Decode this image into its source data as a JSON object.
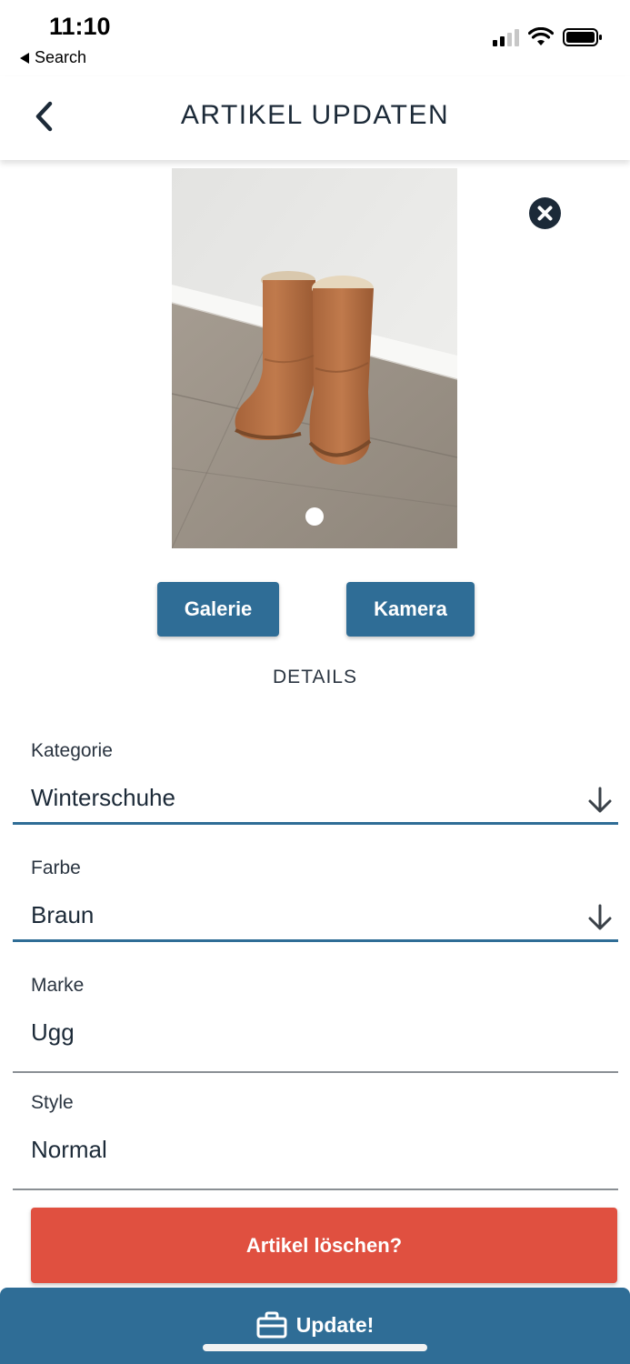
{
  "status_bar": {
    "time": "11:10",
    "back_label": "Search"
  },
  "header": {
    "title": "ARTIKEL UPDATEN"
  },
  "photo": {
    "page_count": 1,
    "current_page": 1
  },
  "buttons": {
    "gallery": "Galerie",
    "camera": "Kamera",
    "delete": "Artikel löschen?",
    "update": "Update!"
  },
  "section": {
    "details": "DETAILS"
  },
  "form": {
    "category": {
      "label": "Kategorie",
      "value": "Winterschuhe"
    },
    "color": {
      "label": "Farbe",
      "value": "Braun"
    },
    "brand": {
      "label": "Marke",
      "value": "Ugg"
    },
    "style": {
      "label": "Style",
      "value": "Normal"
    }
  },
  "colors": {
    "primary": "#2f6d96",
    "danger": "#e05040",
    "text": "#1c2a38"
  },
  "icons": {
    "back": "chevron-left-icon",
    "remove": "close-circle-icon",
    "dropdown": "arrow-down-icon",
    "update": "briefcase-icon"
  }
}
